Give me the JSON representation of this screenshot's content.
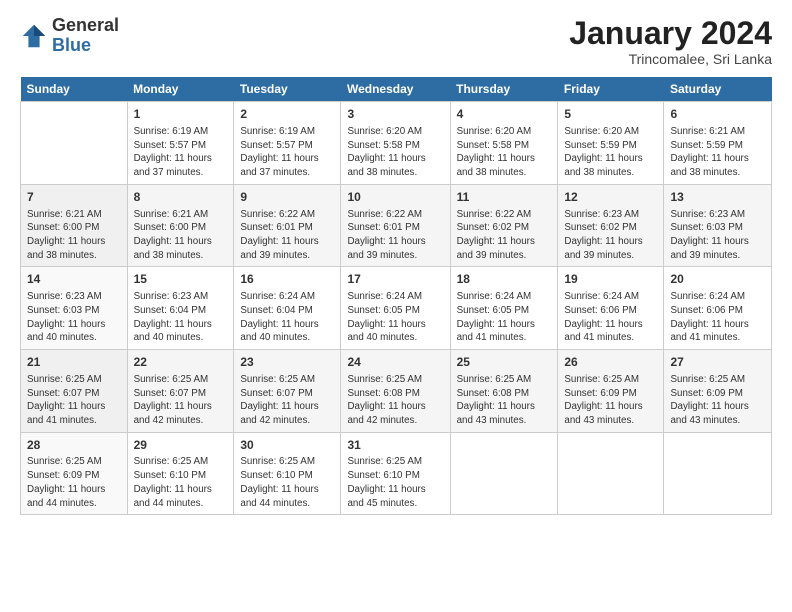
{
  "logo": {
    "general": "General",
    "blue": "Blue"
  },
  "header": {
    "title": "January 2024",
    "location": "Trincomalee, Sri Lanka"
  },
  "weekdays": [
    "Sunday",
    "Monday",
    "Tuesday",
    "Wednesday",
    "Thursday",
    "Friday",
    "Saturday"
  ],
  "weeks": [
    [
      {
        "num": "",
        "info": ""
      },
      {
        "num": "1",
        "info": "Sunrise: 6:19 AM\nSunset: 5:57 PM\nDaylight: 11 hours\nand 37 minutes."
      },
      {
        "num": "2",
        "info": "Sunrise: 6:19 AM\nSunset: 5:57 PM\nDaylight: 11 hours\nand 37 minutes."
      },
      {
        "num": "3",
        "info": "Sunrise: 6:20 AM\nSunset: 5:58 PM\nDaylight: 11 hours\nand 38 minutes."
      },
      {
        "num": "4",
        "info": "Sunrise: 6:20 AM\nSunset: 5:58 PM\nDaylight: 11 hours\nand 38 minutes."
      },
      {
        "num": "5",
        "info": "Sunrise: 6:20 AM\nSunset: 5:59 PM\nDaylight: 11 hours\nand 38 minutes."
      },
      {
        "num": "6",
        "info": "Sunrise: 6:21 AM\nSunset: 5:59 PM\nDaylight: 11 hours\nand 38 minutes."
      }
    ],
    [
      {
        "num": "7",
        "info": "Sunrise: 6:21 AM\nSunset: 6:00 PM\nDaylight: 11 hours\nand 38 minutes."
      },
      {
        "num": "8",
        "info": "Sunrise: 6:21 AM\nSunset: 6:00 PM\nDaylight: 11 hours\nand 38 minutes."
      },
      {
        "num": "9",
        "info": "Sunrise: 6:22 AM\nSunset: 6:01 PM\nDaylight: 11 hours\nand 39 minutes."
      },
      {
        "num": "10",
        "info": "Sunrise: 6:22 AM\nSunset: 6:01 PM\nDaylight: 11 hours\nand 39 minutes."
      },
      {
        "num": "11",
        "info": "Sunrise: 6:22 AM\nSunset: 6:02 PM\nDaylight: 11 hours\nand 39 minutes."
      },
      {
        "num": "12",
        "info": "Sunrise: 6:23 AM\nSunset: 6:02 PM\nDaylight: 11 hours\nand 39 minutes."
      },
      {
        "num": "13",
        "info": "Sunrise: 6:23 AM\nSunset: 6:03 PM\nDaylight: 11 hours\nand 39 minutes."
      }
    ],
    [
      {
        "num": "14",
        "info": "Sunrise: 6:23 AM\nSunset: 6:03 PM\nDaylight: 11 hours\nand 40 minutes."
      },
      {
        "num": "15",
        "info": "Sunrise: 6:23 AM\nSunset: 6:04 PM\nDaylight: 11 hours\nand 40 minutes."
      },
      {
        "num": "16",
        "info": "Sunrise: 6:24 AM\nSunset: 6:04 PM\nDaylight: 11 hours\nand 40 minutes."
      },
      {
        "num": "17",
        "info": "Sunrise: 6:24 AM\nSunset: 6:05 PM\nDaylight: 11 hours\nand 40 minutes."
      },
      {
        "num": "18",
        "info": "Sunrise: 6:24 AM\nSunset: 6:05 PM\nDaylight: 11 hours\nand 41 minutes."
      },
      {
        "num": "19",
        "info": "Sunrise: 6:24 AM\nSunset: 6:06 PM\nDaylight: 11 hours\nand 41 minutes."
      },
      {
        "num": "20",
        "info": "Sunrise: 6:24 AM\nSunset: 6:06 PM\nDaylight: 11 hours\nand 41 minutes."
      }
    ],
    [
      {
        "num": "21",
        "info": "Sunrise: 6:25 AM\nSunset: 6:07 PM\nDaylight: 11 hours\nand 41 minutes."
      },
      {
        "num": "22",
        "info": "Sunrise: 6:25 AM\nSunset: 6:07 PM\nDaylight: 11 hours\nand 42 minutes."
      },
      {
        "num": "23",
        "info": "Sunrise: 6:25 AM\nSunset: 6:07 PM\nDaylight: 11 hours\nand 42 minutes."
      },
      {
        "num": "24",
        "info": "Sunrise: 6:25 AM\nSunset: 6:08 PM\nDaylight: 11 hours\nand 42 minutes."
      },
      {
        "num": "25",
        "info": "Sunrise: 6:25 AM\nSunset: 6:08 PM\nDaylight: 11 hours\nand 43 minutes."
      },
      {
        "num": "26",
        "info": "Sunrise: 6:25 AM\nSunset: 6:09 PM\nDaylight: 11 hours\nand 43 minutes."
      },
      {
        "num": "27",
        "info": "Sunrise: 6:25 AM\nSunset: 6:09 PM\nDaylight: 11 hours\nand 43 minutes."
      }
    ],
    [
      {
        "num": "28",
        "info": "Sunrise: 6:25 AM\nSunset: 6:09 PM\nDaylight: 11 hours\nand 44 minutes."
      },
      {
        "num": "29",
        "info": "Sunrise: 6:25 AM\nSunset: 6:10 PM\nDaylight: 11 hours\nand 44 minutes."
      },
      {
        "num": "30",
        "info": "Sunrise: 6:25 AM\nSunset: 6:10 PM\nDaylight: 11 hours\nand 44 minutes."
      },
      {
        "num": "31",
        "info": "Sunrise: 6:25 AM\nSunset: 6:10 PM\nDaylight: 11 hours\nand 45 minutes."
      },
      {
        "num": "",
        "info": ""
      },
      {
        "num": "",
        "info": ""
      },
      {
        "num": "",
        "info": ""
      }
    ]
  ]
}
